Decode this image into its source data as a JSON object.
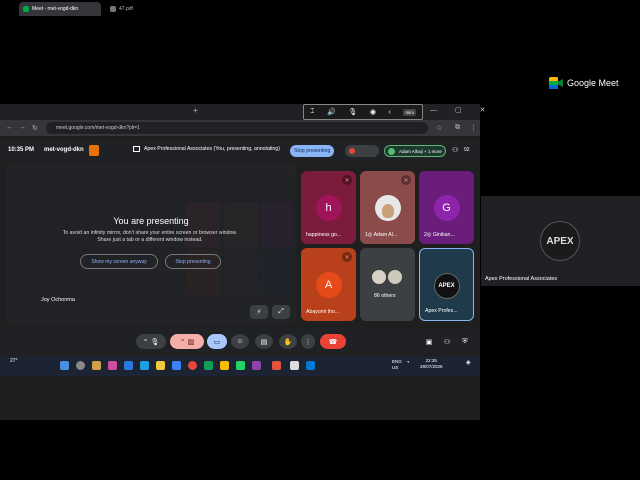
{
  "brand": {
    "name": "Google Meet"
  },
  "side_tile": {
    "name": "Apex Professional Associates",
    "logo_text": "APEX"
  },
  "browser": {
    "tabs": [
      {
        "label": "Meet - met-vogd-dkn"
      },
      {
        "label": "47.pdf"
      }
    ],
    "new_tab": "+",
    "url": "meet.google.com/met-vogd-dkn?pli=1",
    "window_controls": "— ▢ ✕"
  },
  "share_pill": {
    "items": [
      "⌶",
      "🔊",
      "🎙",
      "◉",
      "‹",
      "mini"
    ]
  },
  "meet": {
    "clock": "10:35 PM",
    "code": "met-vogd-dkn",
    "presenting_info": "Apex Professional Associates (You, presenting, annotating)",
    "stop_presenting": "Stop presenting",
    "speaker_chip": "Adam Alhaji + 1 more",
    "count": "92"
  },
  "presenting": {
    "title": "You are presenting",
    "desc_line1": "To avoid an infinity mirror, don't share your entire screen or browser window.",
    "desc_line2": "Share just a tab or a different window instead.",
    "show_btn": "Show my screen anyway",
    "stop_btn": "Stop presenting",
    "presenter_name": "Joy Ochonma"
  },
  "tiles": [
    {
      "initial": "h",
      "name": "happiness go...",
      "bg": "#7b1d3a",
      "avatar": "#a0145b"
    },
    {
      "initial": "",
      "name": "1◎ Adam Al...",
      "bg": "#8c4b4b",
      "avatar": "#e8e8e8"
    },
    {
      "initial": "G",
      "name": "2◎ Ginikan...",
      "bg": "#6a1d7a",
      "avatar": "#8e24aa"
    },
    {
      "initial": "A",
      "name": "Abayomi tho...",
      "bg": "#b8401a",
      "avatar": "#e64a19"
    },
    {
      "initial": "",
      "name": "86 others",
      "bg": "#3c4043",
      "avatar": "#3c4043"
    },
    {
      "initial": "APEX",
      "name": "Apex Profes...",
      "bg": "#1f3a4a",
      "avatar": "#111"
    }
  ],
  "taskbar": {
    "weather": "27°",
    "lang": "ENG",
    "region": "US",
    "time": "22:35",
    "date": "28/07/2026"
  },
  "colors": {
    "accent": "#8ab4f8",
    "end_call": "#ea4335",
    "meet_bg": "#202124"
  }
}
